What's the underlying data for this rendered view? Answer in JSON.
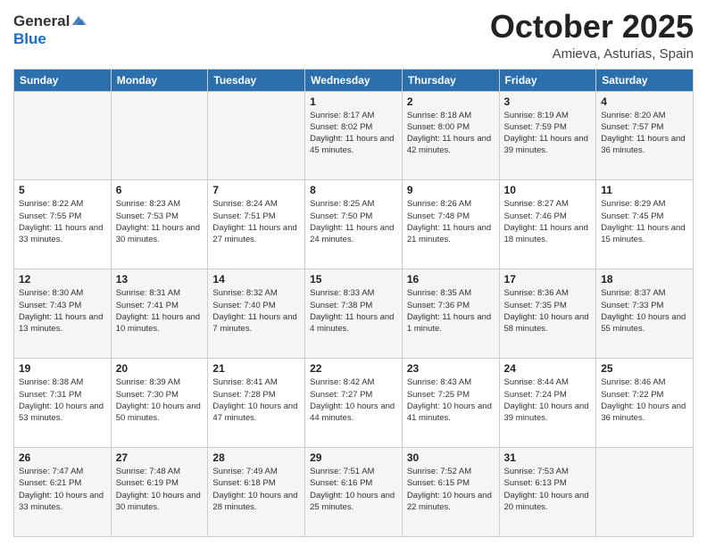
{
  "header": {
    "logo_line1": "General",
    "logo_line2": "Blue",
    "month": "October 2025",
    "location": "Amieva, Asturias, Spain"
  },
  "days_of_week": [
    "Sunday",
    "Monday",
    "Tuesday",
    "Wednesday",
    "Thursday",
    "Friday",
    "Saturday"
  ],
  "weeks": [
    [
      {
        "day": "",
        "info": ""
      },
      {
        "day": "",
        "info": ""
      },
      {
        "day": "",
        "info": ""
      },
      {
        "day": "1",
        "info": "Sunrise: 8:17 AM\nSunset: 8:02 PM\nDaylight: 11 hours\nand 45 minutes."
      },
      {
        "day": "2",
        "info": "Sunrise: 8:18 AM\nSunset: 8:00 PM\nDaylight: 11 hours\nand 42 minutes."
      },
      {
        "day": "3",
        "info": "Sunrise: 8:19 AM\nSunset: 7:59 PM\nDaylight: 11 hours\nand 39 minutes."
      },
      {
        "day": "4",
        "info": "Sunrise: 8:20 AM\nSunset: 7:57 PM\nDaylight: 11 hours\nand 36 minutes."
      }
    ],
    [
      {
        "day": "5",
        "info": "Sunrise: 8:22 AM\nSunset: 7:55 PM\nDaylight: 11 hours\nand 33 minutes."
      },
      {
        "day": "6",
        "info": "Sunrise: 8:23 AM\nSunset: 7:53 PM\nDaylight: 11 hours\nand 30 minutes."
      },
      {
        "day": "7",
        "info": "Sunrise: 8:24 AM\nSunset: 7:51 PM\nDaylight: 11 hours\nand 27 minutes."
      },
      {
        "day": "8",
        "info": "Sunrise: 8:25 AM\nSunset: 7:50 PM\nDaylight: 11 hours\nand 24 minutes."
      },
      {
        "day": "9",
        "info": "Sunrise: 8:26 AM\nSunset: 7:48 PM\nDaylight: 11 hours\nand 21 minutes."
      },
      {
        "day": "10",
        "info": "Sunrise: 8:27 AM\nSunset: 7:46 PM\nDaylight: 11 hours\nand 18 minutes."
      },
      {
        "day": "11",
        "info": "Sunrise: 8:29 AM\nSunset: 7:45 PM\nDaylight: 11 hours\nand 15 minutes."
      }
    ],
    [
      {
        "day": "12",
        "info": "Sunrise: 8:30 AM\nSunset: 7:43 PM\nDaylight: 11 hours\nand 13 minutes."
      },
      {
        "day": "13",
        "info": "Sunrise: 8:31 AM\nSunset: 7:41 PM\nDaylight: 11 hours\nand 10 minutes."
      },
      {
        "day": "14",
        "info": "Sunrise: 8:32 AM\nSunset: 7:40 PM\nDaylight: 11 hours\nand 7 minutes."
      },
      {
        "day": "15",
        "info": "Sunrise: 8:33 AM\nSunset: 7:38 PM\nDaylight: 11 hours\nand 4 minutes."
      },
      {
        "day": "16",
        "info": "Sunrise: 8:35 AM\nSunset: 7:36 PM\nDaylight: 11 hours\nand 1 minute."
      },
      {
        "day": "17",
        "info": "Sunrise: 8:36 AM\nSunset: 7:35 PM\nDaylight: 10 hours\nand 58 minutes."
      },
      {
        "day": "18",
        "info": "Sunrise: 8:37 AM\nSunset: 7:33 PM\nDaylight: 10 hours\nand 55 minutes."
      }
    ],
    [
      {
        "day": "19",
        "info": "Sunrise: 8:38 AM\nSunset: 7:31 PM\nDaylight: 10 hours\nand 53 minutes."
      },
      {
        "day": "20",
        "info": "Sunrise: 8:39 AM\nSunset: 7:30 PM\nDaylight: 10 hours\nand 50 minutes."
      },
      {
        "day": "21",
        "info": "Sunrise: 8:41 AM\nSunset: 7:28 PM\nDaylight: 10 hours\nand 47 minutes."
      },
      {
        "day": "22",
        "info": "Sunrise: 8:42 AM\nSunset: 7:27 PM\nDaylight: 10 hours\nand 44 minutes."
      },
      {
        "day": "23",
        "info": "Sunrise: 8:43 AM\nSunset: 7:25 PM\nDaylight: 10 hours\nand 41 minutes."
      },
      {
        "day": "24",
        "info": "Sunrise: 8:44 AM\nSunset: 7:24 PM\nDaylight: 10 hours\nand 39 minutes."
      },
      {
        "day": "25",
        "info": "Sunrise: 8:46 AM\nSunset: 7:22 PM\nDaylight: 10 hours\nand 36 minutes."
      }
    ],
    [
      {
        "day": "26",
        "info": "Sunrise: 7:47 AM\nSunset: 6:21 PM\nDaylight: 10 hours\nand 33 minutes."
      },
      {
        "day": "27",
        "info": "Sunrise: 7:48 AM\nSunset: 6:19 PM\nDaylight: 10 hours\nand 30 minutes."
      },
      {
        "day": "28",
        "info": "Sunrise: 7:49 AM\nSunset: 6:18 PM\nDaylight: 10 hours\nand 28 minutes."
      },
      {
        "day": "29",
        "info": "Sunrise: 7:51 AM\nSunset: 6:16 PM\nDaylight: 10 hours\nand 25 minutes."
      },
      {
        "day": "30",
        "info": "Sunrise: 7:52 AM\nSunset: 6:15 PM\nDaylight: 10 hours\nand 22 minutes."
      },
      {
        "day": "31",
        "info": "Sunrise: 7:53 AM\nSunset: 6:13 PM\nDaylight: 10 hours\nand 20 minutes."
      },
      {
        "day": "",
        "info": ""
      }
    ]
  ]
}
